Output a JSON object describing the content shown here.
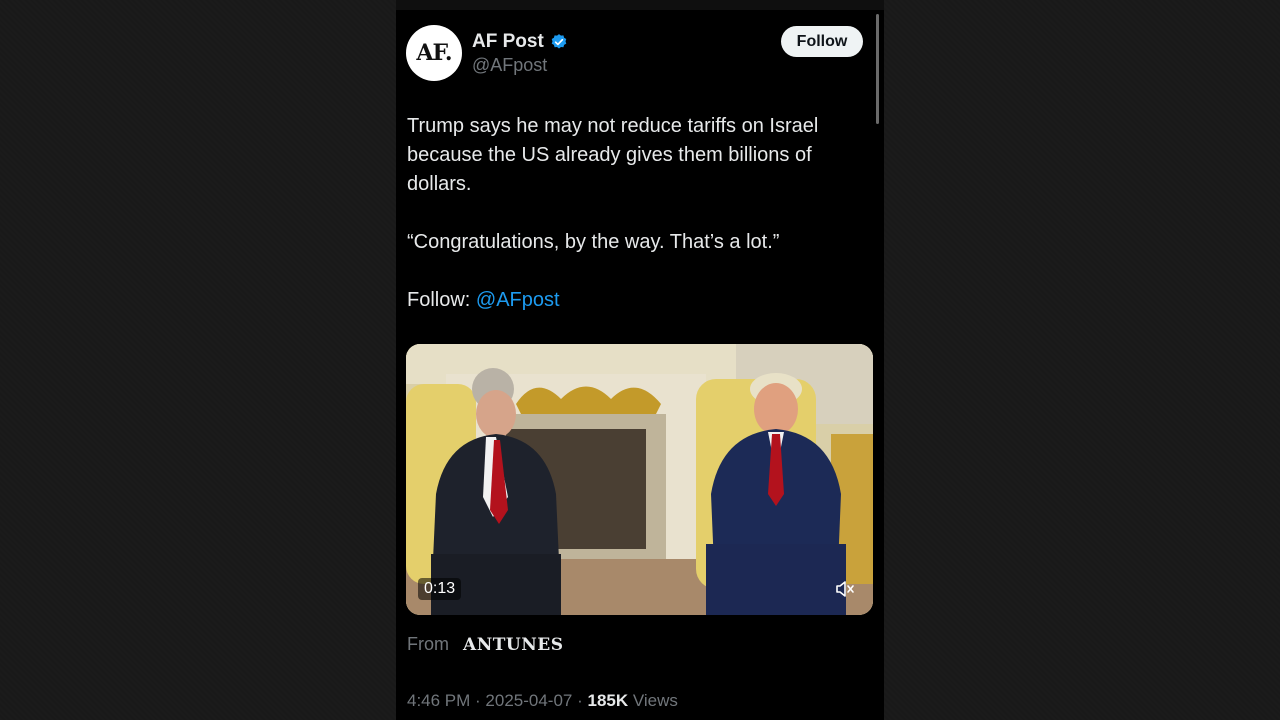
{
  "account": {
    "avatar_text": "AF.",
    "name": "AF Post",
    "handle": "@AFpost",
    "follow_label": "Follow"
  },
  "tweet": {
    "paragraph1": "Trump says he may not reduce tariffs on Israel because the US already gives them billions of dollars.",
    "paragraph2": "“Congratulations, by the way. That’s a lot.”",
    "follow_prefix": "Follow: ",
    "follow_mention": "@AFpost"
  },
  "media": {
    "duration": "0:13",
    "mute_icon": "speaker-muted-icon"
  },
  "source": {
    "from_label": "From",
    "name": "ANTUNES"
  },
  "meta": {
    "time": "4:46 PM",
    "date": "2025-04-07",
    "sep": " · ",
    "views_count": "185K",
    "views_label": "Views"
  },
  "colors": {
    "accent": "#1d9bf0",
    "background": "#000000",
    "text": "#e7e9ea",
    "muted": "#71767b"
  }
}
